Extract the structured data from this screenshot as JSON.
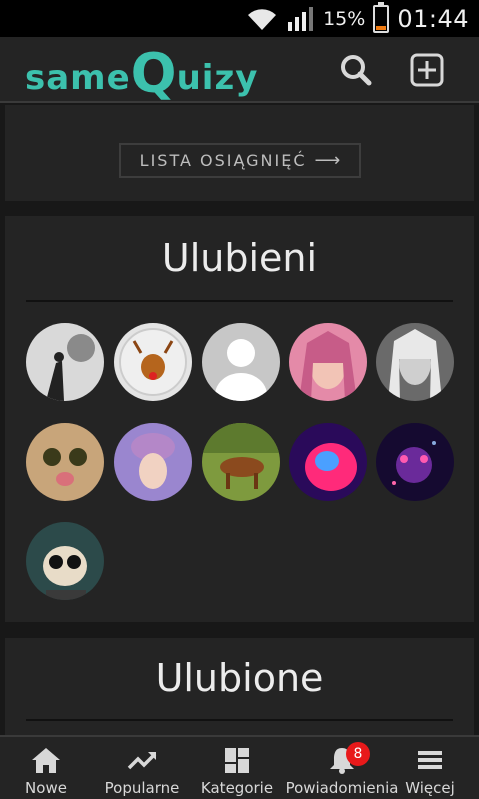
{
  "status_bar": {
    "battery": "15%",
    "time": "01:44",
    "battery_level": 0.15
  },
  "header": {
    "logo_part1": "same",
    "logo_q": "Q",
    "logo_part2": "uizy"
  },
  "achievements": {
    "button_label": "LISTA OSIĄGNIĘĆ",
    "arrow": "⟶"
  },
  "favorites_users": {
    "title": "Ulubieni",
    "avatars": [
      "avatar-1",
      "avatar-2",
      "avatar-3",
      "avatar-4",
      "avatar-5",
      "avatar-6",
      "avatar-7",
      "avatar-8",
      "avatar-9",
      "avatar-10",
      "avatar-11"
    ]
  },
  "favorites_quizzes": {
    "title": "Ulubione"
  },
  "bottom_nav": {
    "items": [
      {
        "label": "Nowe",
        "icon": "home-icon"
      },
      {
        "label": "Popularne",
        "icon": "trending-icon"
      },
      {
        "label": "Kategorie",
        "icon": "grid-icon"
      },
      {
        "label": "Powiadomienia",
        "icon": "bell-icon",
        "badge": "8"
      },
      {
        "label": "Więcej",
        "icon": "menu-icon"
      }
    ]
  },
  "colors": {
    "accent": "#3cc1ad",
    "background": "#181818",
    "card": "#242424",
    "badge": "#e8191a"
  }
}
